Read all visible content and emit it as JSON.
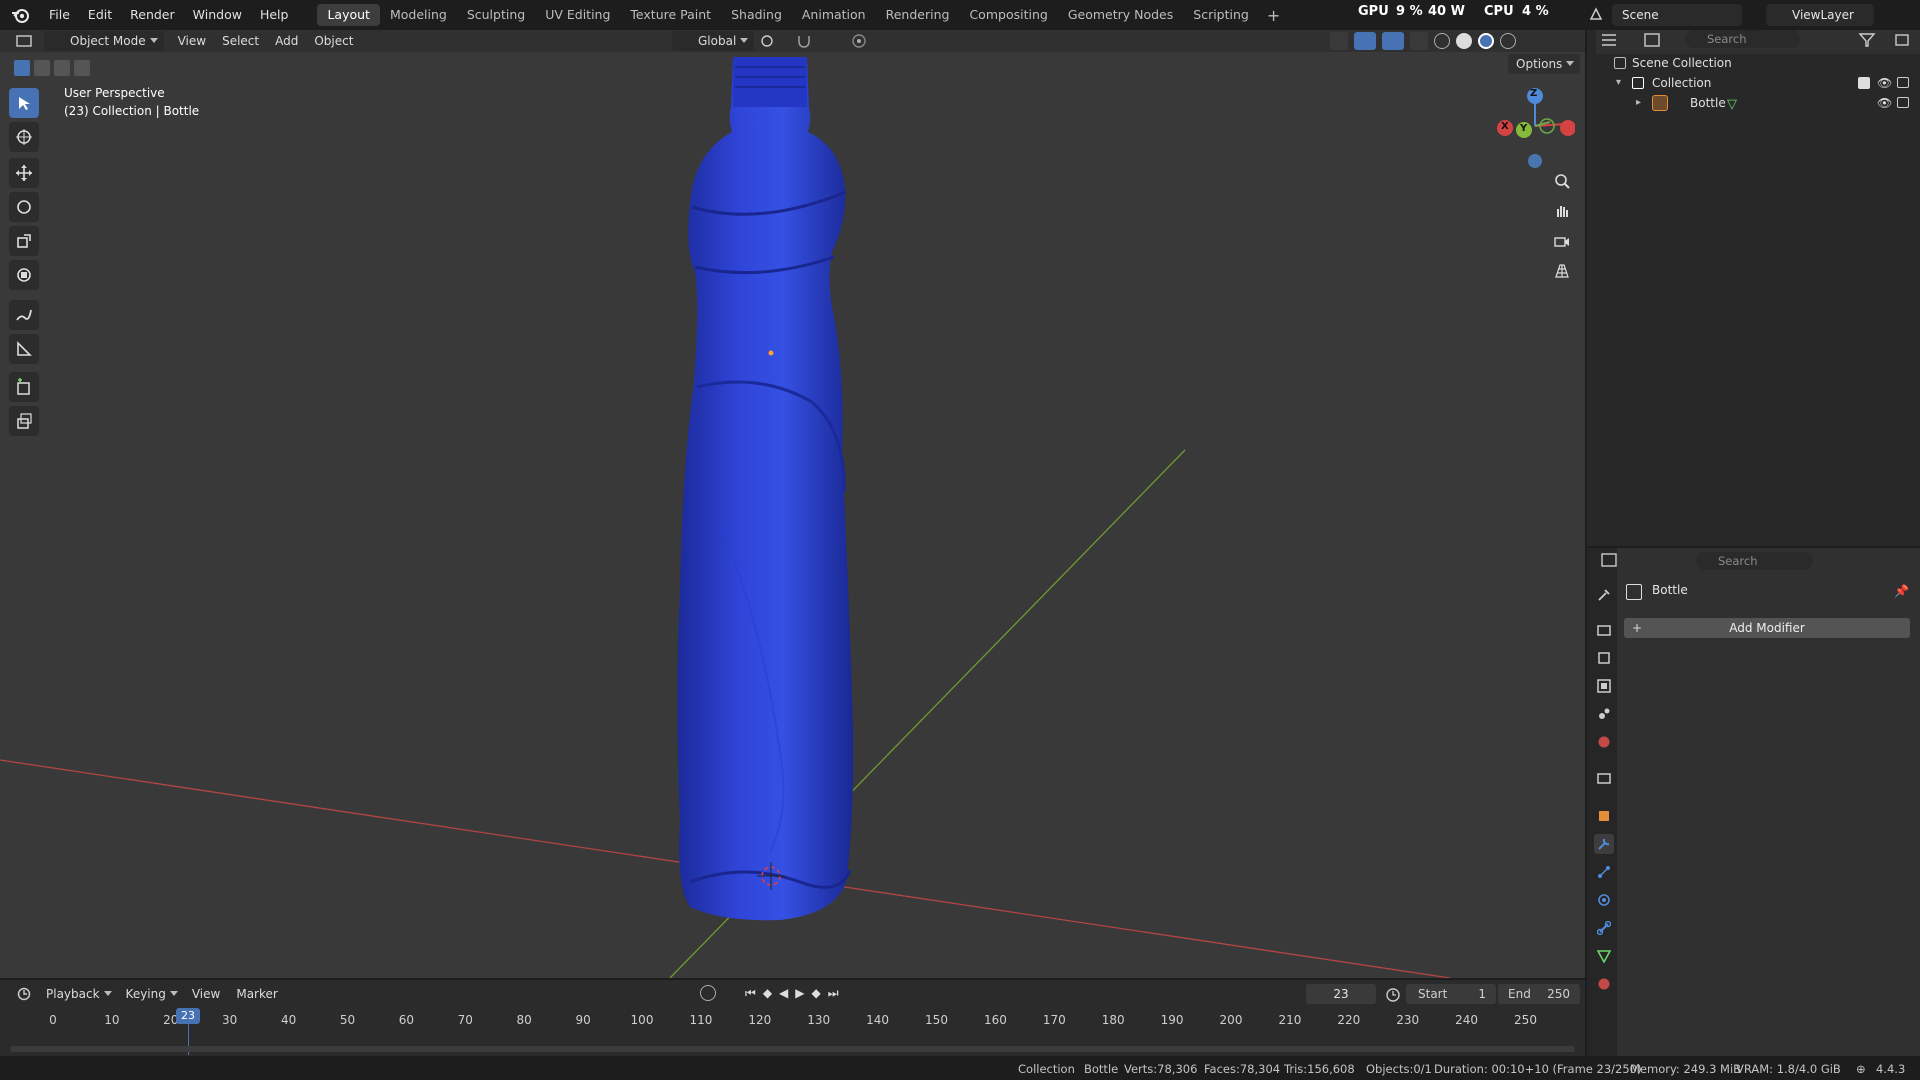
{
  "menu": {
    "file": "File",
    "edit": "Edit",
    "render": "Render",
    "window": "Window",
    "help": "Help"
  },
  "workspaces": [
    "Layout",
    "Modeling",
    "Sculpting",
    "UV Editing",
    "Texture Paint",
    "Shading",
    "Animation",
    "Rendering",
    "Compositing",
    "Geometry Nodes",
    "Scripting"
  ],
  "stats": {
    "gpu_label": "GPU",
    "gpu_value": "9 %",
    "gpu_power": "40 W",
    "cpu_label": "CPU",
    "cpu_value": "4 %"
  },
  "scene": {
    "name": "Scene",
    "view_layer": "ViewLayer"
  },
  "viewport_header": {
    "mode": "Object Mode",
    "view": "View",
    "select": "Select",
    "add": "Add",
    "object": "Object",
    "orientation": "Global",
    "options": "Options"
  },
  "overlay": {
    "line1": "User Perspective",
    "line2": "(23) Collection | Bottle"
  },
  "gizmo": {
    "z": "Z",
    "y": "Y",
    "x": "X"
  },
  "outliner": {
    "search_placeholder": "Search",
    "scene_collection": "Scene Collection",
    "collection": "Collection",
    "object": "Bottle"
  },
  "properties": {
    "search_placeholder": "Search",
    "object_name": "Bottle",
    "add_modifier": "Add Modifier"
  },
  "timeline": {
    "playback": "Playback",
    "keying": "Keying",
    "view": "View",
    "marker": "Marker",
    "current_frame": "23",
    "start_label": "Start",
    "start_value": "1",
    "end_label": "End",
    "end_value": "250",
    "ticks": [
      "0",
      "10",
      "20",
      "30",
      "40",
      "50",
      "60",
      "70",
      "80",
      "90",
      "100",
      "110",
      "120",
      "130",
      "140",
      "150",
      "160",
      "170",
      "180",
      "190",
      "200",
      "210",
      "220",
      "230",
      "240",
      "250"
    ],
    "playhead": "23"
  },
  "status": {
    "collection": "Collection",
    "object": "Bottle",
    "verts": "Verts:78,306",
    "faces": "Faces:78,304",
    "tris": "Tris:156,608",
    "objects": "Objects:0/1",
    "duration": "Duration: 00:10+10 (Frame 23/250)",
    "memory": "Memory: 249.3 MiB",
    "vram": "VRAM: 1.8/4.0 GiB",
    "version": "4.4.3"
  },
  "colors": {
    "accent": "#4772b3",
    "bottle": "#2a3fd6",
    "x_axis": "#d54242",
    "y_axis": "#86b83a"
  }
}
